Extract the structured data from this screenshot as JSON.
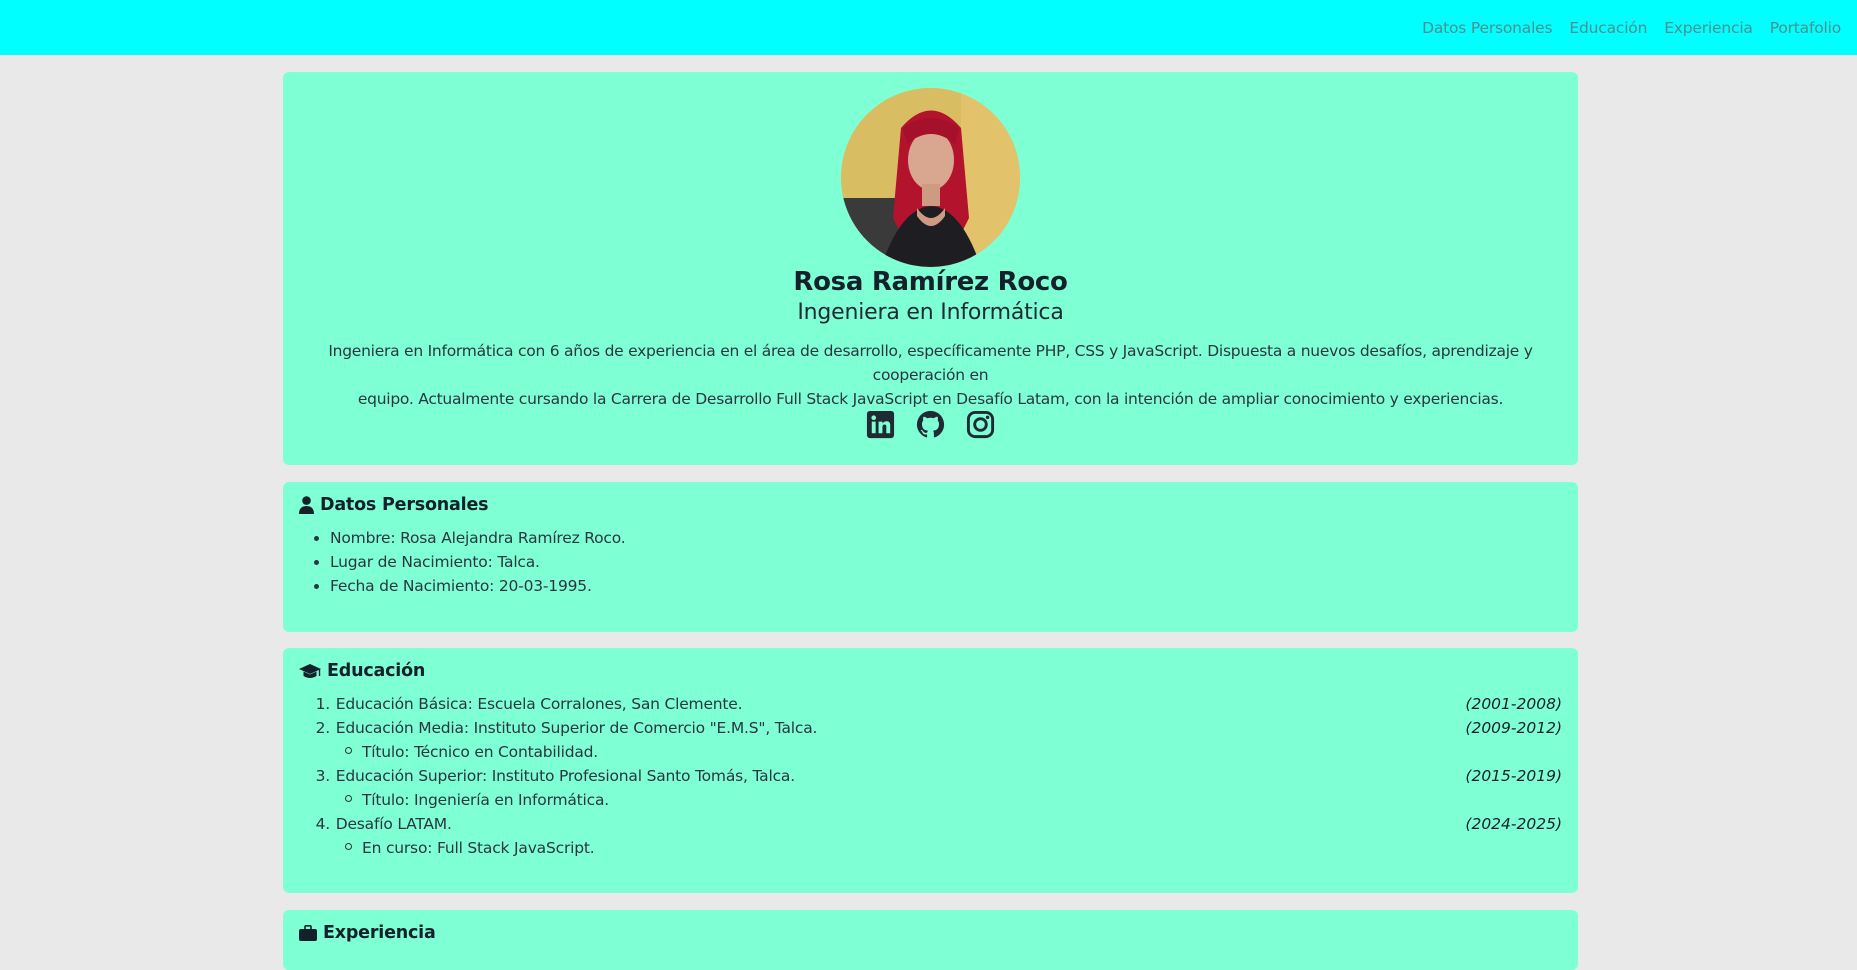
{
  "nav": {
    "links": [
      "Datos Personales",
      "Educación",
      "Experiencia",
      "Portafolio"
    ]
  },
  "profile": {
    "name": "Rosa Ramírez Roco",
    "role": "Ingeniera en Informática",
    "bio_line1": "Ingeniera en Informática con 6 años de experiencia en el área de desarrollo, específicamente PHP, CSS y JavaScript. Dispuesta a nuevos desafíos, aprendizaje y cooperación en",
    "bio_line2": "equipo. Actualmente cursando la Carrera de Desarrollo Full Stack JavaScript en Desafío Latam, con la intención de ampliar conocimiento y experiencias.",
    "socials": [
      "linkedin-icon",
      "github-icon",
      "instagram-icon"
    ]
  },
  "personal": {
    "title": "Datos Personales",
    "items": [
      "Nombre: Rosa Alejandra Ramírez Roco.",
      "Lugar de Nacimiento: Talca.",
      "Fecha de Nacimiento: 20-03-1995."
    ]
  },
  "education": {
    "title": "Educación",
    "entries": [
      {
        "num": "1.",
        "text": "Educación Básica: Escuela Corralones, San Clemente.",
        "years": "(2001-2008)"
      },
      {
        "num": "2.",
        "text": "Educación Media: Instituto Superior de Comercio \"E.M.S\", Talca.",
        "years": "(2009-2012)",
        "sub": "Título: Técnico en Contabilidad."
      },
      {
        "num": "3.",
        "text": "Educación Superior: Instituto Profesional Santo Tomás, Talca.",
        "years": "(2015-2019)",
        "sub": "Título: Ingeniería en Informática."
      },
      {
        "num": "4.",
        "text": "Desafío LATAM.",
        "years": "(2024-2025)",
        "sub": "En curso: Full Stack JavaScript."
      }
    ]
  },
  "experience": {
    "title": "Experiencia"
  },
  "colors": {
    "navbar": "#00ffff",
    "card": "#7fffd4",
    "page": "#e9e9e9"
  }
}
